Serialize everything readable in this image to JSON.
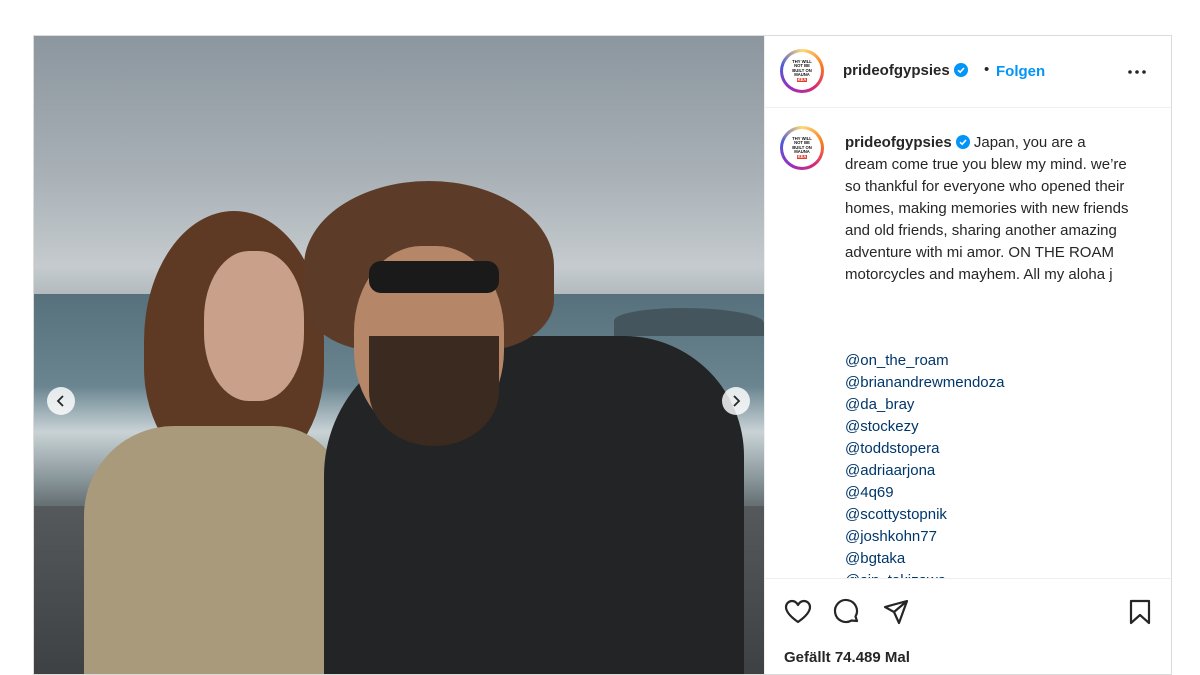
{
  "account": {
    "username": "prideofgypsies",
    "follow_label": "Folgen",
    "dot": "•",
    "avatar_text": [
      "THY WILL",
      "NOT BE",
      "BUILT ON",
      "MAUNA",
      "KEA"
    ],
    "avatar_red_text": "KEA"
  },
  "caption": {
    "username": "prideofgypsies",
    "text": "Japan, you are a dream come true you blew my mind. we’re so thankful for everyone who opened their homes, making memories with new friends and old friends, sharing another amazing adventure with mi amor. ON THE ROAM motorcycles and mayhem. All my aloha j"
  },
  "mentions": [
    "@on_the_roam",
    "@brianandrewmendoza",
    "@da_bray",
    "@stockezy",
    "@toddstopera",
    "@adriaarjona",
    "@4q69",
    "@scottystopnik",
    "@joshkohn77",
    "@bgtaka",
    "@sin_takizawa"
  ],
  "likes_label": "Gefällt 74.489 Mal",
  "icons": {
    "prev": "chevron-left-icon",
    "next": "chevron-right-icon",
    "like": "heart-icon",
    "comment": "comment-icon",
    "share": "paper-plane-icon",
    "save": "bookmark-icon",
    "more": "more-horizontal-icon",
    "verified": "verified-badge-icon"
  },
  "colors": {
    "link": "#00376b",
    "follow": "#0095f6",
    "verified": "#0095f6",
    "text": "#262626"
  }
}
